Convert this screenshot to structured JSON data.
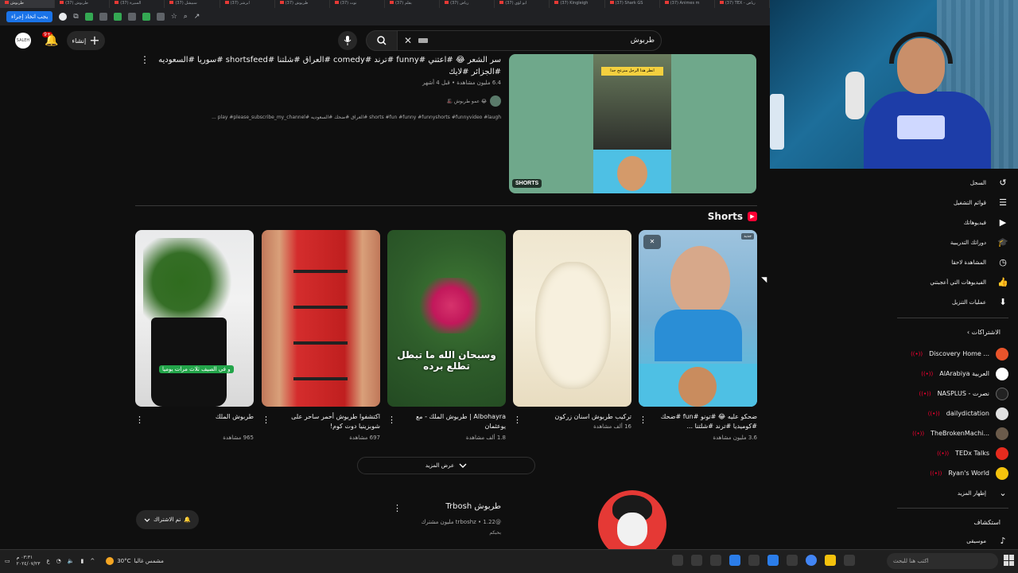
{
  "browser": {
    "tabs": [
      "طربوش",
      "(37) طربوش",
      "(37) السيرة",
      "(37) سبيشل",
      "(37) ابرشر",
      "(37) طربوش",
      "(37) نوت",
      "(37) بقلم",
      "(37) رياض",
      "(37) ابو لؤي",
      "(37) Kingleigh",
      "(37) Shark GS",
      "(37) Animes m",
      "(37) TEX - رياض"
    ],
    "bookmark_pill": "يجب اتخاذ إجراء"
  },
  "header": {
    "search_value": "طربوش",
    "create_label": "إنشاء",
    "notification_count": "9+",
    "avatar_text": "SALEH"
  },
  "result1": {
    "title": "سر الشعر 😂 #اعتني #funny #ترند #comedy #العراق #شلتنا #shortsfeed #سوريا #السعوديه #الجزائر #لايك",
    "meta": "6.4 مليون مشاهدة • قبل 4 أشهر",
    "channel": "🎩 عمو طربوش 😂",
    "desc": "shorts #fun #funny #funnyshorts #funnyvideo #laugh #العراق #ضحك #السعوديه #play #please_subscribe_my_channel ...",
    "thumb_caption": "انظر هذا الرجل منزعج جدا",
    "shorts_badge": "SHORTS"
  },
  "shorts_shelf": {
    "heading": "Shorts",
    "show_more": "عرض المزيد",
    "items": [
      {
        "title": "طربوش الملك",
        "views": "965 مشاهدة",
        "caption": "و في الصيف ثلاث مرات يوميا"
      },
      {
        "title": "اكتشفوا طربوش أحمر ساحر على شوبزينيا دوت كوم!",
        "views": "697 مشاهدة"
      },
      {
        "title": "Albohayra | طربوش الملك - مع يوعثمان",
        "views": "1.8 ألف مشاهدة",
        "caption": "وسبحان الله ما تبطل تطلع برده"
      },
      {
        "title": "تركيب طربوش اسنان زركون",
        "views": "16 ألف مشاهدة"
      },
      {
        "title": "ضحكو عليه 😂 #تونو #fun #ضحك #كوميديا #ترند #شلتنا ...",
        "views": "3.6 مليون مشاهدة",
        "badge": "جديد"
      }
    ]
  },
  "channel_result": {
    "name": "طربوش Trbosh",
    "meta": "@trboshz • 1.22 مليون مشترك",
    "desc": "بحبكم",
    "subscribed_label": "تم الاشتراك"
  },
  "sidebar": {
    "items": [
      {
        "label": "السجل",
        "icon": "history-icon"
      },
      {
        "label": "قوائم التشغيل",
        "icon": "playlist-icon"
      },
      {
        "label": "فيديوهاتك",
        "icon": "your-videos-icon"
      },
      {
        "label": "دوراتك التدريبية",
        "icon": "courses-icon"
      },
      {
        "label": "المشاهدة لاحقا",
        "icon": "watch-later-icon"
      },
      {
        "label": "الفيديوهات التي أعجبتني",
        "icon": "like-icon"
      },
      {
        "label": "عمليات التنزيل",
        "icon": "download-icon"
      }
    ],
    "subscriptions_heading": "الاشتراكات",
    "subscriptions": [
      {
        "name": "Discovery Home ...",
        "color": "#e8542b"
      },
      {
        "name": "AlArabiya العربية",
        "color": "#ffffff"
      },
      {
        "name": "NASPLUS - نصرت",
        "color": "#222222"
      },
      {
        "name": "dailydictation",
        "color": "#e0e0e0"
      },
      {
        "name": "TheBrokenMachi...",
        "color": "#6b5b4b"
      },
      {
        "name": "TEDx Talks",
        "color": "#e62b1e"
      },
      {
        "name": "Ryan's World",
        "color": "#f4c20d"
      }
    ],
    "show_more": "إظهار المزيد",
    "explore_heading": "استكشاف",
    "explore_first": "موسيقى"
  },
  "taskbar": {
    "time": "٠٣:٣١ م",
    "date": "٢٠٢٤/٠٧/٢٣",
    "weather_temp": "30°C",
    "weather_text": "مشمس غالبا",
    "search_placeholder": "اكتب هنا للبحث"
  }
}
